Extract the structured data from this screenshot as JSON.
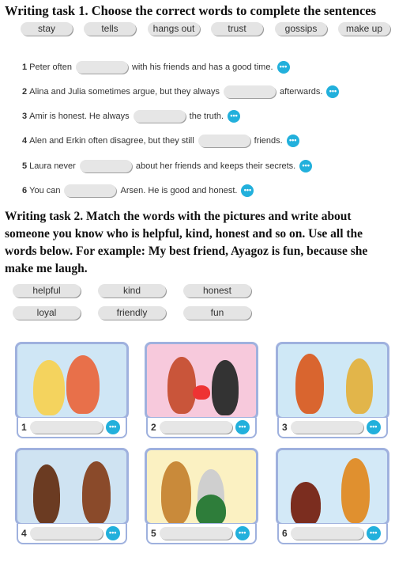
{
  "task1": {
    "heading": "Writing task 1. Choose the correct words to complete the sentences",
    "word_bank": [
      "stay",
      "tells",
      "hangs out",
      "trust",
      "gossips",
      "make up"
    ],
    "sentences": [
      {
        "num": "1",
        "before": "Peter often",
        "after": "with his friends and has a good time."
      },
      {
        "num": "2",
        "before": "Alina and Julia sometimes argue, but they always",
        "after": "afterwards."
      },
      {
        "num": "3",
        "before": "Amir is honest. He always",
        "after": "the truth."
      },
      {
        "num": "4",
        "before": "Alen and Erkin often disagree, but they still",
        "after": "friends."
      },
      {
        "num": "5",
        "before": "Laura never",
        "after": "about her friends and keeps their secrets."
      },
      {
        "num": "6",
        "before": "You can",
        "after": "Arsen. He is good and honest."
      }
    ],
    "audio_icon": "speech-dots-icon",
    "accent": "#22b0dc"
  },
  "task2": {
    "heading_lines": [
      "Writing task 2. Match the words with the pictures and write about",
      "someone you know who is helpful, kind, honest and so on. Use all the",
      "words below. For example: My best friend, Ayagoz is fun, because she",
      "make me laugh."
    ],
    "word_bank": [
      "helpful",
      "kind",
      "honest",
      "loyal",
      "friendly",
      "fun"
    ],
    "pictures": [
      {
        "num": "1",
        "bg": "#cfe6f5"
      },
      {
        "num": "2",
        "bg": "#f7c9dc"
      },
      {
        "num": "3",
        "bg": "#cfe8f6"
      },
      {
        "num": "4",
        "bg": "#cfe3f2"
      },
      {
        "num": "5",
        "bg": "#fbf1c2"
      },
      {
        "num": "6",
        "bg": "#d3e9f7"
      }
    ]
  }
}
